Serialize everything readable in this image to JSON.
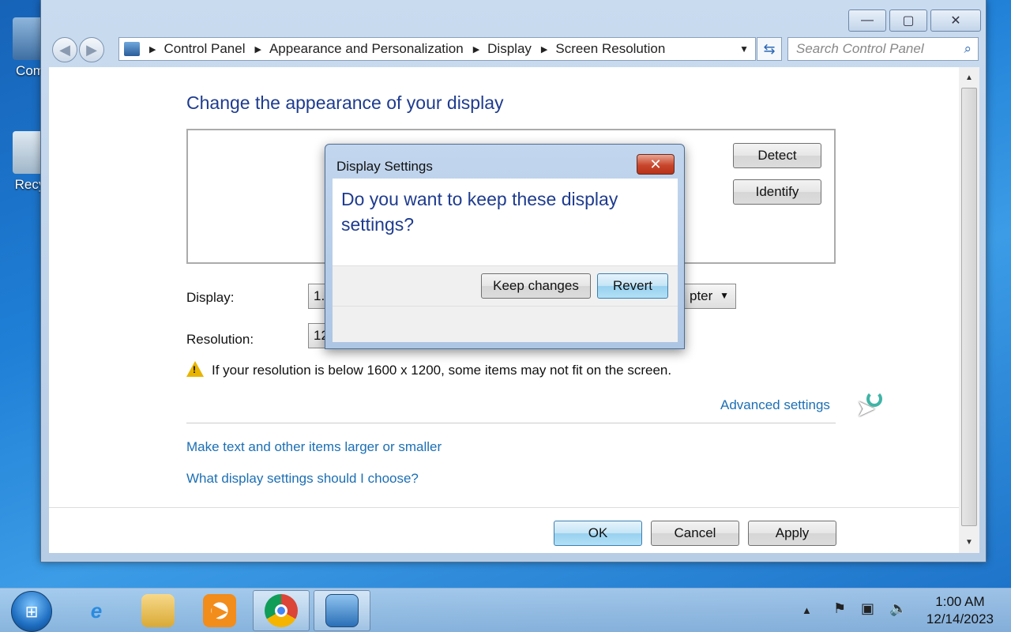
{
  "desktop": {
    "icons": [
      {
        "label": "Com",
        "name": "computer-icon"
      },
      {
        "label": "Recy",
        "name": "recycle-bin-icon"
      }
    ]
  },
  "window": {
    "controls": {
      "minimize": "—",
      "maximize": "▢",
      "close": "✕"
    },
    "address": {
      "crumbs": [
        "Control Panel",
        "Appearance and Personalization",
        "Display",
        "Screen Resolution"
      ]
    },
    "search": {
      "placeholder": "Search Control Panel"
    },
    "page": {
      "title": "Change the appearance of your display",
      "detect_label": "Detect",
      "identify_label": "Identify",
      "display_label": "Display:",
      "display_value": "1.",
      "display_value_tail": "pter",
      "resolution_label": "Resolution:",
      "resolution_value": "12",
      "warning_text": "If your resolution is below 1600 x 1200, some items may not fit on the screen.",
      "advanced_link": "Advanced settings",
      "link_text_size": "Make text and other items larger or smaller",
      "link_help": "What display settings should I choose?",
      "ok_label": "OK",
      "cancel_label": "Cancel",
      "apply_label": "Apply"
    }
  },
  "dialog": {
    "title": "Display Settings",
    "message": "Do you want to keep these display settings?",
    "keep_label": "Keep changes",
    "revert_label": "Revert"
  },
  "taskbar": {
    "items": [
      "start",
      "internet-explorer",
      "file-explorer",
      "media-player",
      "chrome",
      "control-panel"
    ],
    "clock_time": "1:00 AM",
    "clock_date": "12/14/2023"
  },
  "colors": {
    "heading": "#1e3b8f",
    "link": "#1c6fb4",
    "close_button": "#c8462c"
  }
}
